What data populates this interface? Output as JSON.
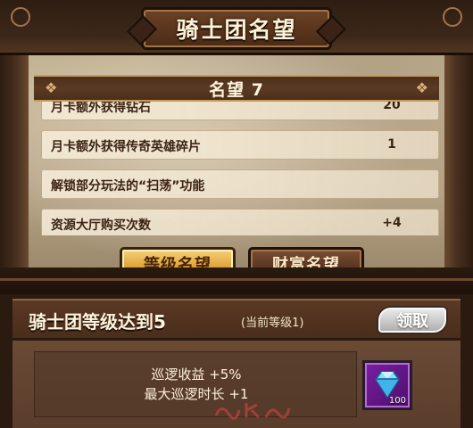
{
  "window": {
    "title": "骑士团名望"
  },
  "header": {
    "rank_label": "名望 7"
  },
  "benefits": [
    {
      "label": "月卡额外获得钻石",
      "value": "20"
    },
    {
      "label": "月卡额外获得传奇英雄碎片",
      "value": "1"
    },
    {
      "label": "解锁部分玩法的“扫荡”功能",
      "value": ""
    },
    {
      "label": "资源大厅购买次数",
      "value": "+4"
    }
  ],
  "tabs": [
    {
      "label": "等级名望",
      "active": true
    },
    {
      "label": "财富名望",
      "active": false
    }
  ],
  "quest": {
    "title": "骑士团等级达到5",
    "current_level": "(当前等级1)",
    "claim_label": "领取"
  },
  "rewards": {
    "lines": [
      "巡逻收益 +5%",
      "最大巡逻时长 +1"
    ],
    "item": {
      "icon": "diamond-icon",
      "count": "100"
    }
  },
  "colors": {
    "accent_gold": "#e1a83d",
    "frame_brown": "#4a2d1b",
    "item_purple": "#7b1fa2"
  }
}
